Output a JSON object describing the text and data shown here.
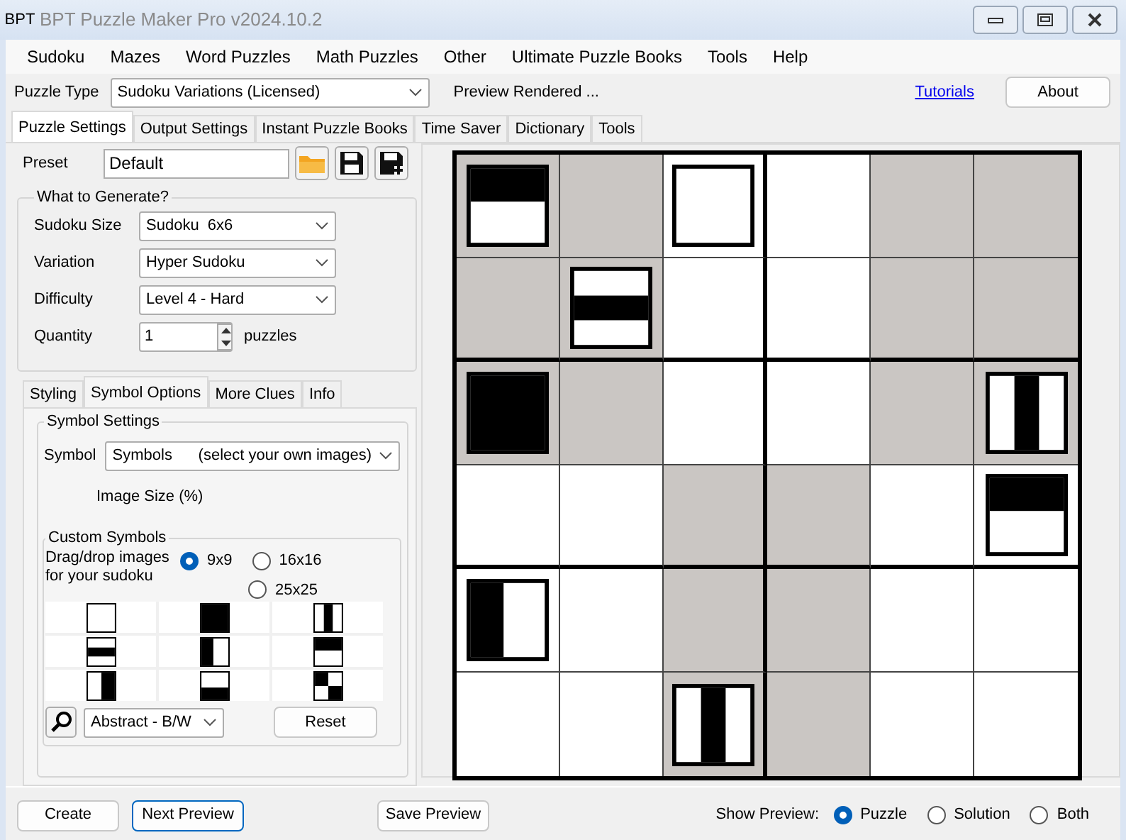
{
  "window": {
    "title": "BPT Puzzle Maker Pro v2024.10.2",
    "logo_text": "BPT"
  },
  "menu": [
    "Sudoku",
    "Mazes",
    "Word Puzzles",
    "Math Puzzles",
    "Other",
    "Ultimate Puzzle Books",
    "Tools",
    "Help"
  ],
  "toolbar": {
    "puzzle_type_label": "Puzzle Type",
    "puzzle_type": "Sudoku Variations (Licensed)",
    "status": "Preview Rendered ...",
    "tutorials_link": "Tutorials",
    "about_button": "About"
  },
  "main_tabs": [
    {
      "label": "Puzzle Settings",
      "selected": true
    },
    {
      "label": "Output Settings",
      "selected": false
    },
    {
      "label": "Instant Puzzle Books",
      "selected": false
    },
    {
      "label": "Time Saver",
      "selected": false
    },
    {
      "label": "Dictionary",
      "selected": false
    },
    {
      "label": "Tools",
      "selected": false
    }
  ],
  "preset": {
    "label": "Preset",
    "value": "Default"
  },
  "what_to_generate": {
    "title": "What to Generate?",
    "fields": [
      {
        "label": "Sudoku Size",
        "value": "Sudoku  6x6"
      },
      {
        "label": "Variation",
        "value": "Hyper Sudoku"
      },
      {
        "label": "Difficulty",
        "value": "Level 4 - Hard"
      }
    ],
    "quantity": {
      "label": "Quantity",
      "value": "1",
      "unit": "puzzles"
    }
  },
  "sub_tabs": [
    {
      "label": "Styling",
      "selected": false
    },
    {
      "label": "Symbol Options",
      "selected": true
    },
    {
      "label": "More Clues",
      "selected": false
    },
    {
      "label": "Info",
      "selected": false
    }
  ],
  "symbol_settings": {
    "title": "Symbol Settings",
    "symbol_label": "Symbol",
    "symbol_value": "Symbols      (select your own images)",
    "image_size_label": "Image Size (%)"
  },
  "custom_symbols": {
    "title": "Custom Symbols",
    "hint": "Drag/drop images for your sudoku",
    "grid_sizes": [
      {
        "label": "9x9",
        "selected": true
      },
      {
        "label": "16x16",
        "selected": false
      },
      {
        "label": "25x25",
        "selected": false
      }
    ],
    "symbols": [
      {
        "kind": "empty"
      },
      {
        "kind": "full"
      },
      {
        "kind": "vertical-band"
      },
      {
        "kind": "middle-band"
      },
      {
        "kind": "left-half"
      },
      {
        "kind": "top-half"
      },
      {
        "kind": "right-half"
      },
      {
        "kind": "bottom-half"
      },
      {
        "kind": "checker"
      }
    ],
    "symbol_set": "Abstract - B/W",
    "reset_button": "Reset"
  },
  "puzzle_grid": {
    "rows": [
      [
        {
          "shaded": true,
          "kind": "top-half"
        },
        {
          "shaded": true
        },
        {
          "shaded": false,
          "kind": "empty"
        },
        {
          "shaded": false
        },
        {
          "shaded": true
        },
        {
          "shaded": true
        }
      ],
      [
        {
          "shaded": true
        },
        {
          "shaded": true,
          "kind": "middle-band"
        },
        {
          "shaded": false
        },
        {
          "shaded": false
        },
        {
          "shaded": true
        },
        {
          "shaded": true
        }
      ],
      [
        {
          "shaded": true,
          "kind": "full"
        },
        {
          "shaded": true
        },
        {
          "shaded": false
        },
        {
          "shaded": false
        },
        {
          "shaded": true
        },
        {
          "shaded": true,
          "kind": "vertical-band"
        }
      ],
      [
        {
          "shaded": false
        },
        {
          "shaded": false
        },
        {
          "shaded": true
        },
        {
          "shaded": true
        },
        {
          "shaded": false
        },
        {
          "shaded": false,
          "kind": "top-half"
        }
      ],
      [
        {
          "shaded": false,
          "kind": "left-half"
        },
        {
          "shaded": false
        },
        {
          "shaded": true
        },
        {
          "shaded": true
        },
        {
          "shaded": false
        },
        {
          "shaded": false
        }
      ],
      [
        {
          "shaded": false
        },
        {
          "shaded": false
        },
        {
          "shaded": true,
          "kind": "vertical-band"
        },
        {
          "shaded": true
        },
        {
          "shaded": false
        },
        {
          "shaded": false
        }
      ]
    ]
  },
  "bottom_buttons": [
    {
      "label": "Create",
      "focused": false
    },
    {
      "label": "Next Preview",
      "focused": true
    },
    {
      "label": "Save Preview",
      "focused": false
    }
  ],
  "show_preview": {
    "label": "Show Preview:",
    "options": [
      {
        "label": "Puzzle",
        "selected": true
      },
      {
        "label": "Solution",
        "selected": false
      },
      {
        "label": "Both",
        "selected": false
      }
    ]
  }
}
